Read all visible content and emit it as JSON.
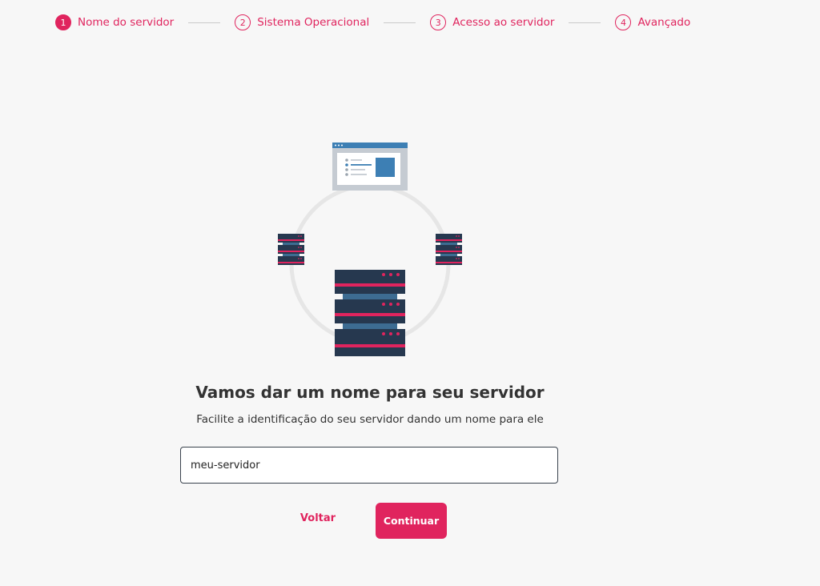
{
  "stepper": {
    "steps": [
      {
        "number": "1",
        "label": "Nome do servidor"
      },
      {
        "number": "2",
        "label": "Sistema Operacional"
      },
      {
        "number": "3",
        "label": "Acesso ao servidor"
      },
      {
        "number": "4",
        "label": "Avançado"
      }
    ],
    "active_step": 1
  },
  "main": {
    "title": "Vamos dar um nome para seu servidor",
    "subtitle": "Facilite a identificação do seu servidor dando um nome para ele",
    "server_name_value": "meu-servidor"
  },
  "actions": {
    "back_label": "Voltar",
    "continue_label": "Continuar"
  },
  "colors": {
    "accent": "#e0245e",
    "server_dark": "#26384f",
    "server_blue": "#3d6c92",
    "background": "#f7f7f7"
  }
}
